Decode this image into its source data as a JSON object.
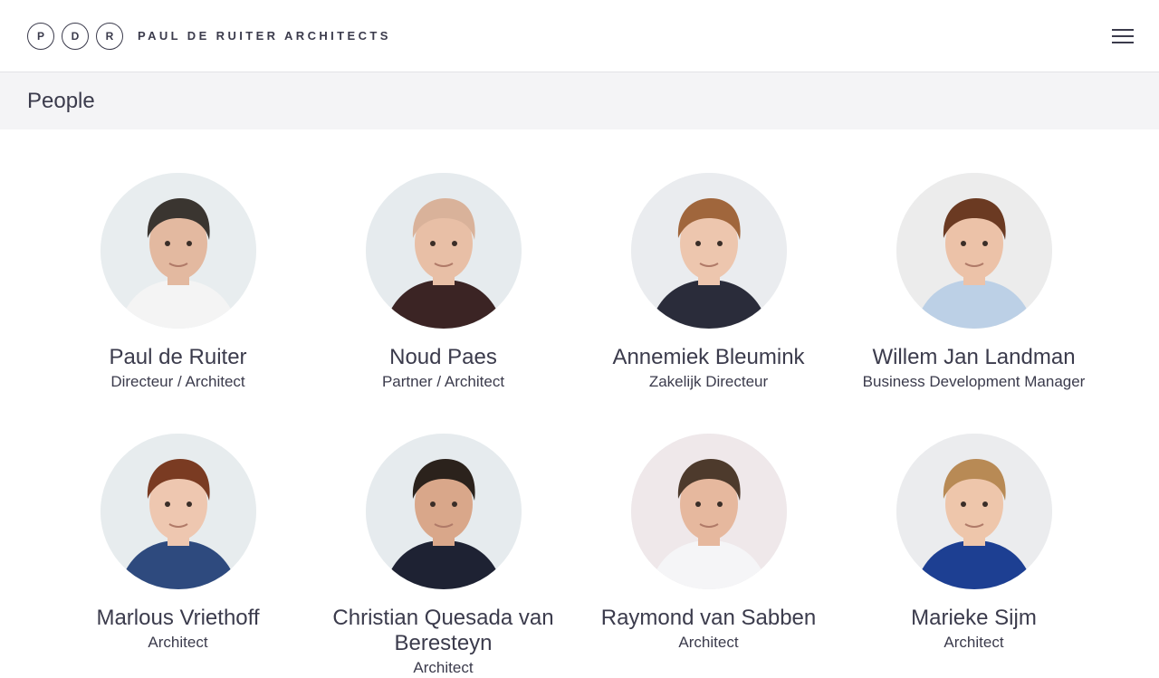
{
  "brand": {
    "letters": [
      "P",
      "D",
      "R"
    ],
    "name": "PAUL DE RUITER ARCHITECTS"
  },
  "page": {
    "title": "People"
  },
  "people": [
    {
      "name": "Paul de Ruiter",
      "role": "Directeur / Architect",
      "hair": "#3a3530",
      "skin": "#e3b9a0",
      "shirt": "#f4f4f4",
      "bg": "#e8edef"
    },
    {
      "name": "Noud Paes",
      "role": "Partner / Architect",
      "hair": "#d9b29a",
      "skin": "#e8bfa6",
      "shirt": "#3b2424",
      "bg": "#e6ebee"
    },
    {
      "name": "Annemiek Bleumink",
      "role": "Zakelijk Directeur",
      "hair": "#a0663c",
      "skin": "#edc6ae",
      "shirt": "#2a2c3a",
      "bg": "#eaecef"
    },
    {
      "name": "Willem Jan Landman",
      "role": "Business Development Manager",
      "hair": "#6b3a22",
      "skin": "#ecc2a8",
      "shirt": "#bcd0e6",
      "bg": "#ececec"
    },
    {
      "name": "Marlous Vriethoff",
      "role": "Architect",
      "hair": "#7a3b22",
      "skin": "#eec7b0",
      "shirt": "#2e4a7e",
      "bg": "#e7ecee"
    },
    {
      "name": "Christian Quesada van Beresteyn",
      "role": "Architect",
      "hair": "#2b221c",
      "skin": "#d9a78a",
      "shirt": "#1e2233",
      "bg": "#e6ebee"
    },
    {
      "name": "Raymond van Sabben",
      "role": "Architect",
      "hair": "#4d3a2c",
      "skin": "#e6b89e",
      "shirt": "#f5f5f7",
      "bg": "#efe8ea"
    },
    {
      "name": "Marieke Sijm",
      "role": "Architect",
      "hair": "#b88a55",
      "skin": "#eec6ab",
      "shirt": "#1d3f92",
      "bg": "#ebecee"
    }
  ]
}
